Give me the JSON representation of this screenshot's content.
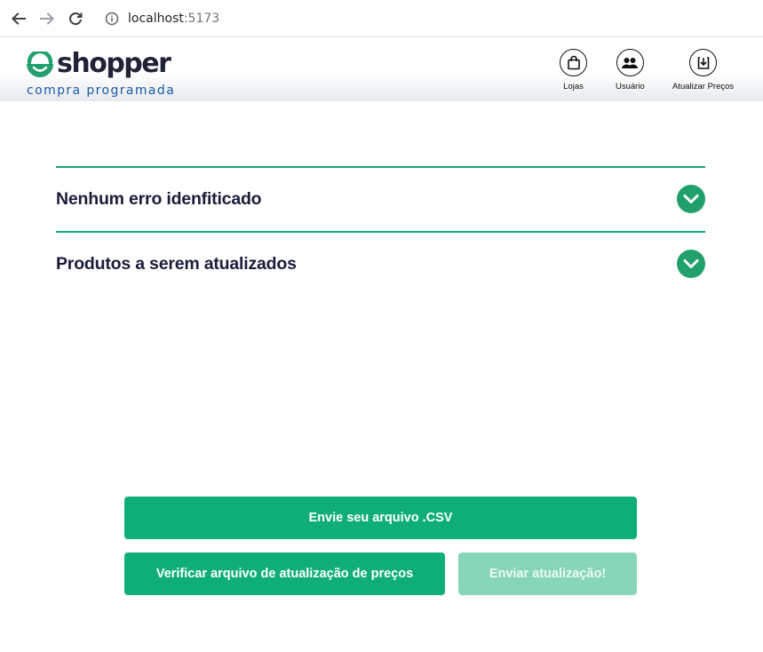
{
  "browser": {
    "url_host": "localhost",
    "url_port": ":5173"
  },
  "header": {
    "logo_word": "shopper",
    "logo_tagline": "compra programada",
    "nav": [
      {
        "label": "Lojas",
        "icon": "shopping-bag-icon"
      },
      {
        "label": "Usuário",
        "icon": "users-icon"
      },
      {
        "label": "Atualizar Preços",
        "icon": "download-icon"
      }
    ]
  },
  "accordions": [
    {
      "title": "Nenhum erro idenfiticado"
    },
    {
      "title": "Produtos a serem atualizados"
    }
  ],
  "actions": {
    "upload_label": "Envie seu arquivo .CSV",
    "verify_label": "Verificar arquivo de atualização de preços",
    "send_label": "Enviar atualização!"
  },
  "colors": {
    "accent": "#0fae78",
    "accent_disabled": "#86d6b7",
    "divider": "#13a475",
    "heading": "#1a1d3a",
    "brand_blue": "#1b5aa4"
  }
}
